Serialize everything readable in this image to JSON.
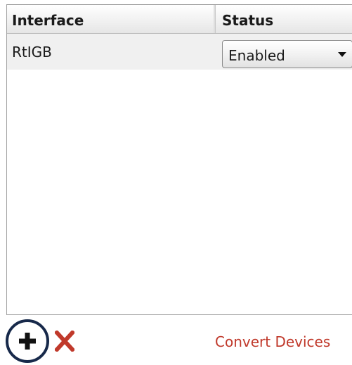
{
  "table": {
    "columns": {
      "interface": "Interface",
      "status": "Status"
    },
    "rows": [
      {
        "interface": "RtIGB",
        "status": "Enabled"
      }
    ]
  },
  "toolbar": {
    "add_icon": "plus-icon",
    "remove_icon": "red-x-icon",
    "convert_label": "Convert Devices"
  },
  "colors": {
    "add_icon": "#111111",
    "add_ring": "#17294a",
    "remove_icon": "#c0392b",
    "convert_link": "#c0392b"
  }
}
